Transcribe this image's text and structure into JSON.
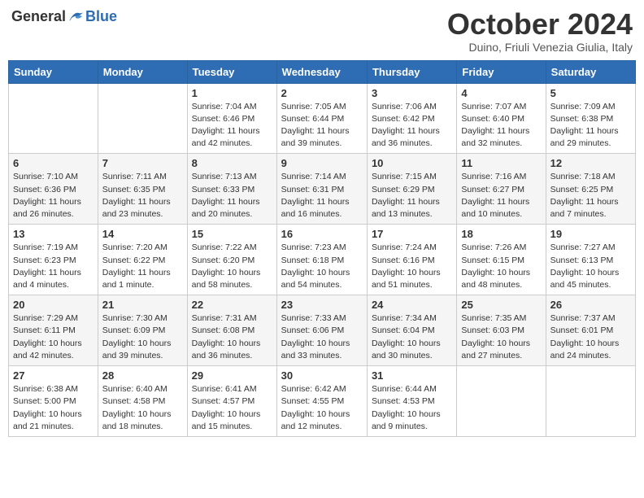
{
  "header": {
    "logo_general": "General",
    "logo_blue": "Blue",
    "month_title": "October 2024",
    "subtitle": "Duino, Friuli Venezia Giulia, Italy"
  },
  "days_of_week": [
    "Sunday",
    "Monday",
    "Tuesday",
    "Wednesday",
    "Thursday",
    "Friday",
    "Saturday"
  ],
  "weeks": [
    [
      {
        "num": "",
        "info": ""
      },
      {
        "num": "",
        "info": ""
      },
      {
        "num": "1",
        "info": "Sunrise: 7:04 AM\nSunset: 6:46 PM\nDaylight: 11 hours and 42 minutes."
      },
      {
        "num": "2",
        "info": "Sunrise: 7:05 AM\nSunset: 6:44 PM\nDaylight: 11 hours and 39 minutes."
      },
      {
        "num": "3",
        "info": "Sunrise: 7:06 AM\nSunset: 6:42 PM\nDaylight: 11 hours and 36 minutes."
      },
      {
        "num": "4",
        "info": "Sunrise: 7:07 AM\nSunset: 6:40 PM\nDaylight: 11 hours and 32 minutes."
      },
      {
        "num": "5",
        "info": "Sunrise: 7:09 AM\nSunset: 6:38 PM\nDaylight: 11 hours and 29 minutes."
      }
    ],
    [
      {
        "num": "6",
        "info": "Sunrise: 7:10 AM\nSunset: 6:36 PM\nDaylight: 11 hours and 26 minutes."
      },
      {
        "num": "7",
        "info": "Sunrise: 7:11 AM\nSunset: 6:35 PM\nDaylight: 11 hours and 23 minutes."
      },
      {
        "num": "8",
        "info": "Sunrise: 7:13 AM\nSunset: 6:33 PM\nDaylight: 11 hours and 20 minutes."
      },
      {
        "num": "9",
        "info": "Sunrise: 7:14 AM\nSunset: 6:31 PM\nDaylight: 11 hours and 16 minutes."
      },
      {
        "num": "10",
        "info": "Sunrise: 7:15 AM\nSunset: 6:29 PM\nDaylight: 11 hours and 13 minutes."
      },
      {
        "num": "11",
        "info": "Sunrise: 7:16 AM\nSunset: 6:27 PM\nDaylight: 11 hours and 10 minutes."
      },
      {
        "num": "12",
        "info": "Sunrise: 7:18 AM\nSunset: 6:25 PM\nDaylight: 11 hours and 7 minutes."
      }
    ],
    [
      {
        "num": "13",
        "info": "Sunrise: 7:19 AM\nSunset: 6:23 PM\nDaylight: 11 hours and 4 minutes."
      },
      {
        "num": "14",
        "info": "Sunrise: 7:20 AM\nSunset: 6:22 PM\nDaylight: 11 hours and 1 minute."
      },
      {
        "num": "15",
        "info": "Sunrise: 7:22 AM\nSunset: 6:20 PM\nDaylight: 10 hours and 58 minutes."
      },
      {
        "num": "16",
        "info": "Sunrise: 7:23 AM\nSunset: 6:18 PM\nDaylight: 10 hours and 54 minutes."
      },
      {
        "num": "17",
        "info": "Sunrise: 7:24 AM\nSunset: 6:16 PM\nDaylight: 10 hours and 51 minutes."
      },
      {
        "num": "18",
        "info": "Sunrise: 7:26 AM\nSunset: 6:15 PM\nDaylight: 10 hours and 48 minutes."
      },
      {
        "num": "19",
        "info": "Sunrise: 7:27 AM\nSunset: 6:13 PM\nDaylight: 10 hours and 45 minutes."
      }
    ],
    [
      {
        "num": "20",
        "info": "Sunrise: 7:29 AM\nSunset: 6:11 PM\nDaylight: 10 hours and 42 minutes."
      },
      {
        "num": "21",
        "info": "Sunrise: 7:30 AM\nSunset: 6:09 PM\nDaylight: 10 hours and 39 minutes."
      },
      {
        "num": "22",
        "info": "Sunrise: 7:31 AM\nSunset: 6:08 PM\nDaylight: 10 hours and 36 minutes."
      },
      {
        "num": "23",
        "info": "Sunrise: 7:33 AM\nSunset: 6:06 PM\nDaylight: 10 hours and 33 minutes."
      },
      {
        "num": "24",
        "info": "Sunrise: 7:34 AM\nSunset: 6:04 PM\nDaylight: 10 hours and 30 minutes."
      },
      {
        "num": "25",
        "info": "Sunrise: 7:35 AM\nSunset: 6:03 PM\nDaylight: 10 hours and 27 minutes."
      },
      {
        "num": "26",
        "info": "Sunrise: 7:37 AM\nSunset: 6:01 PM\nDaylight: 10 hours and 24 minutes."
      }
    ],
    [
      {
        "num": "27",
        "info": "Sunrise: 6:38 AM\nSunset: 5:00 PM\nDaylight: 10 hours and 21 minutes."
      },
      {
        "num": "28",
        "info": "Sunrise: 6:40 AM\nSunset: 4:58 PM\nDaylight: 10 hours and 18 minutes."
      },
      {
        "num": "29",
        "info": "Sunrise: 6:41 AM\nSunset: 4:57 PM\nDaylight: 10 hours and 15 minutes."
      },
      {
        "num": "30",
        "info": "Sunrise: 6:42 AM\nSunset: 4:55 PM\nDaylight: 10 hours and 12 minutes."
      },
      {
        "num": "31",
        "info": "Sunrise: 6:44 AM\nSunset: 4:53 PM\nDaylight: 10 hours and 9 minutes."
      },
      {
        "num": "",
        "info": ""
      },
      {
        "num": "",
        "info": ""
      }
    ]
  ]
}
